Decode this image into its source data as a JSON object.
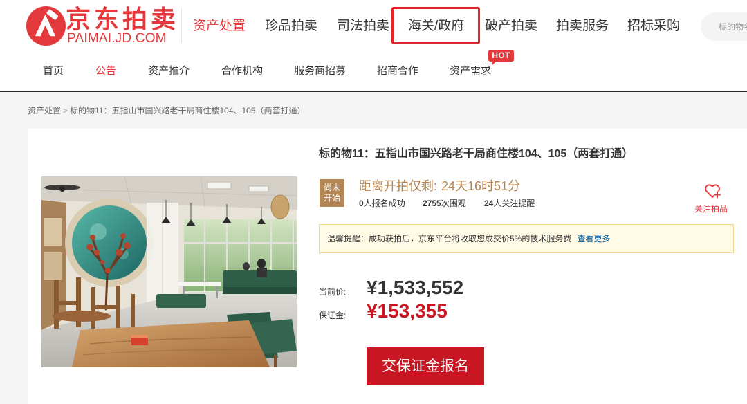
{
  "brand": {
    "name": "京东拍卖",
    "domain": "PAIMAI.JD.COM",
    "logo_icon": "jd-paimai-logo-icon"
  },
  "main_nav": {
    "items": [
      {
        "label": "资产处置",
        "active": true
      },
      {
        "label": "珍品拍卖",
        "active": false
      },
      {
        "label": "司法拍卖",
        "active": false
      },
      {
        "label": "海关/政府",
        "active": false
      },
      {
        "label": "破产拍卖",
        "active": false
      },
      {
        "label": "拍卖服务",
        "active": false
      },
      {
        "label": "招标采购",
        "active": false
      }
    ]
  },
  "search": {
    "placeholder": "标的物名"
  },
  "sub_nav": {
    "items": [
      {
        "label": "首页",
        "active": false
      },
      {
        "label": "公告",
        "active": true
      },
      {
        "label": "资产推介",
        "active": false
      },
      {
        "label": "合作机构",
        "active": false
      },
      {
        "label": "服务商招募",
        "active": false
      },
      {
        "label": "招商合作",
        "active": false
      },
      {
        "label": "资产需求",
        "active": false,
        "badge": "HOT"
      }
    ]
  },
  "breadcrumb": {
    "root": "资产处置",
    "separator": ">",
    "current": "标的物11：五指山市国兴路老干局商住楼104、105（两套打通）"
  },
  "lot": {
    "title": "标的物11：五指山市国兴路老干局商住楼104、105（两套打通）",
    "status": {
      "line1": "尚未",
      "line2": "开始"
    },
    "countdown": {
      "label": "距离开拍仅剩:",
      "value": "24天16时51分"
    },
    "stats": [
      {
        "value": "0",
        "label": "人报名成功"
      },
      {
        "value": "2755",
        "label": "次围观"
      },
      {
        "value": "24",
        "label": "人关注提醒"
      }
    ],
    "follow": {
      "label": "关注拍品",
      "icon": "heart-plus-icon"
    },
    "notice": {
      "text": "温馨提醒：成功获拍后，京东平台将收取您成交价5%的技术服务费",
      "link": "查看更多"
    },
    "price": {
      "current_label": "当前价:",
      "current": "¥1,533,552",
      "deposit_label": "保证金:",
      "deposit": "¥153,355"
    },
    "cta_label": "交保证金报名"
  },
  "colors": {
    "brand_red": "#e4393c",
    "cta_red": "#c81623",
    "price_red": "#c81623",
    "countdown_gold": "#b1844f",
    "status_badge": "#b38654",
    "link_blue": "#005ea7",
    "notice_bg": "#fffbe7",
    "notice_border": "#f2d98f",
    "annotation_red": "#e8242b",
    "header_rule": "#2b2b2b",
    "page_bg": "#f5f5f5"
  }
}
